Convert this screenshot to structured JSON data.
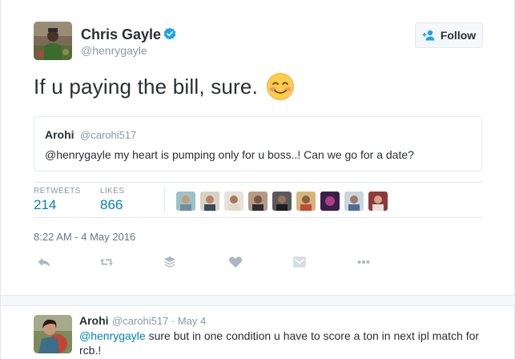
{
  "author": {
    "name": "Chris Gayle",
    "handle": "@henrygayle",
    "verified": true
  },
  "follow_button": {
    "label": "Follow",
    "icon": "add-user-icon"
  },
  "tweet": {
    "text": "If u paying the bill, sure.",
    "emoji": "smiling-face-with-blushing-cheeks"
  },
  "quoted_tweet": {
    "name": "Arohi",
    "handle": "@carohi517",
    "text": "@henrygayle my heart is pumping only for u boss..! Can we go for a date?"
  },
  "stats": {
    "retweets_label": "RETWEETS",
    "retweets_value": "214",
    "likes_label": "LIKES",
    "likes_value": "866"
  },
  "timestamp": "8:22 AM - 4 May 2016",
  "actions": [
    "reply-icon",
    "retweet-icon",
    "buffer-icon",
    "like-icon",
    "mail-icon",
    "more-icon"
  ],
  "reply": {
    "name": "Arohi",
    "meta": "@carohi517 · May 4",
    "mention": "@henrygayle",
    "text": " sure but in one condition u have to score a ton in next ipl match for rcb.!"
  },
  "colors": {
    "link": "#0084b4",
    "muted": "#8899a6",
    "text": "#292f33",
    "border": "#e1e8ed",
    "verified": "#1da1f2"
  }
}
